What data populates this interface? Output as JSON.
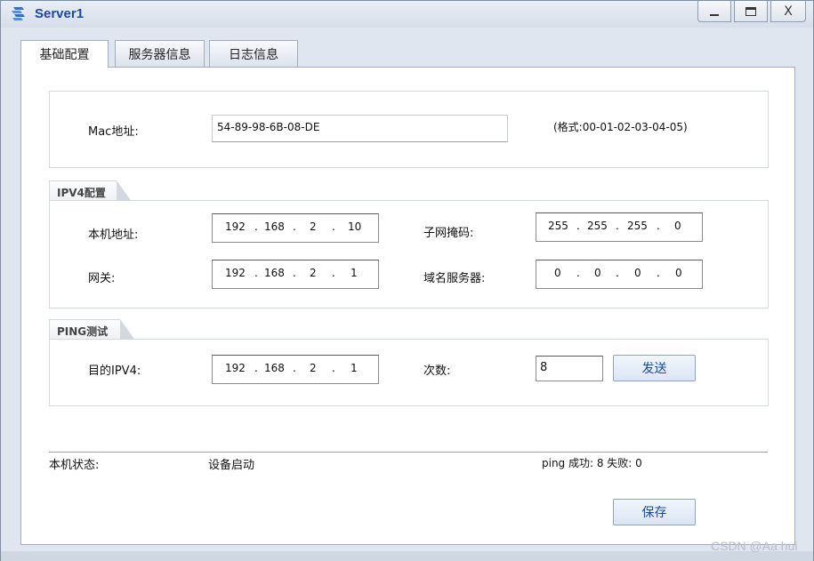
{
  "window": {
    "title": "Server1",
    "minimize_label": "_",
    "maximize_label": "□",
    "close_label": "X"
  },
  "tabs": [
    {
      "label": "基础配置",
      "active": true
    },
    {
      "label": "服务器信息",
      "active": false
    },
    {
      "label": "日志信息",
      "active": false
    }
  ],
  "mac": {
    "label": "Mac地址:",
    "value": "54-89-98-6B-08-DE",
    "format_hint": "(格式:00-01-02-03-04-05)"
  },
  "ipv4": {
    "group_title": "IPV4配置",
    "local_address": {
      "label": "本机地址:",
      "octets": [
        "192",
        "168",
        "2",
        "10"
      ]
    },
    "subnet_mask": {
      "label": "子网掩码:",
      "octets": [
        "255",
        "255",
        "255",
        "0"
      ]
    },
    "gateway": {
      "label": "网关:",
      "octets": [
        "192",
        "168",
        "2",
        "1"
      ]
    },
    "dns": {
      "label": "域名服务器:",
      "octets": [
        "0",
        "0",
        "0",
        "0"
      ]
    }
  },
  "ping": {
    "group_title": "PING测试",
    "dest": {
      "label": "目的IPV4:",
      "octets": [
        "192",
        "168",
        "2",
        "1"
      ]
    },
    "count_label": "次数:",
    "count_value": "8",
    "send_label": "发送"
  },
  "status": {
    "label": "本机状态:",
    "value": "设备启动",
    "ping_summary": "ping 成功: 8   失败: 0"
  },
  "save_label": "保存",
  "watermark": "CSDN @Aa hui",
  "colors": {
    "accent": "#1a4aa0",
    "window_bg": "#dfe6ef",
    "panel_bg": "#ffffff"
  }
}
